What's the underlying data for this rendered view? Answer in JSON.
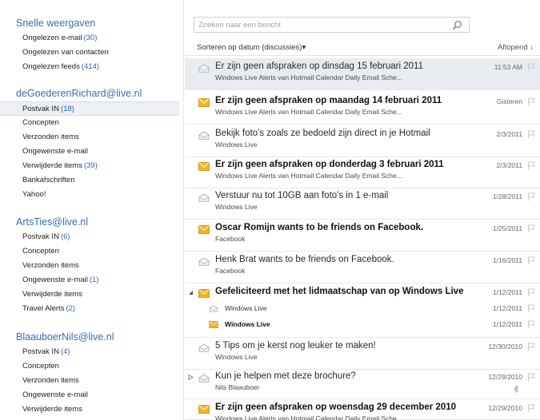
{
  "nav": {
    "quick_views": {
      "header": "Snelle weergaven",
      "items": [
        {
          "label": "Ongelezen e-mail",
          "count": "(30)"
        },
        {
          "label": "Ongelezen van contacten",
          "count": ""
        },
        {
          "label": "Ongelezen feeds",
          "count": "(414)"
        }
      ]
    },
    "accounts": [
      {
        "header": "deGoederenRichard@live.nl",
        "items": [
          {
            "label": "Postvak IN",
            "count": "(18)",
            "selected": true
          },
          {
            "label": "Concepten",
            "count": ""
          },
          {
            "label": "Verzonden items",
            "count": ""
          },
          {
            "label": "Ongewenste e-mail",
            "count": ""
          },
          {
            "label": "Verwijderde items",
            "count": "(39)"
          },
          {
            "label": "Bankafschriften",
            "count": ""
          },
          {
            "label": "Yahoo!",
            "count": ""
          }
        ]
      },
      {
        "header": "ArtsTies@live.nl",
        "items": [
          {
            "label": "Postvak IN",
            "count": "(6)"
          },
          {
            "label": "Concepten",
            "count": ""
          },
          {
            "label": "Verzonden items",
            "count": ""
          },
          {
            "label": "Ongewenste e-mail",
            "count": "(1)"
          },
          {
            "label": "Verwijderde items",
            "count": ""
          },
          {
            "label": "Travel Alerts",
            "count": "(2)"
          }
        ]
      },
      {
        "header": "BlaauboerNils@live.nl",
        "items": [
          {
            "label": "Postvak IN",
            "count": "(4)"
          },
          {
            "label": "Concepten",
            "count": ""
          },
          {
            "label": "Verzonden items",
            "count": ""
          },
          {
            "label": "Ongewenste e-mail",
            "count": ""
          },
          {
            "label": "Verwijderde items",
            "count": ""
          }
        ]
      }
    ]
  },
  "search": {
    "placeholder": "Zoeken naar een bericht",
    "icon": "search-icon"
  },
  "sort": {
    "label": "Sorteren op datum (discussies)",
    "arrow": "▾",
    "order": "Aflopend ↓"
  },
  "messages": [
    {
      "subject": "Er zijn geen afspraken op dinsdag 15 februari 2011",
      "sender": "Windows Live Alerts van Hotmail Calendar Daily Email Sche...",
      "date": "11:53 AM",
      "unread": false,
      "selected": true
    },
    {
      "subject": "Er zijn geen afspraken op maandag 14 februari 2011",
      "sender": "Windows Live Alerts van Hotmail Calendar Daily Email Sche...",
      "date": "Gisteren",
      "unread": true
    },
    {
      "subject": "Bekijk foto's zoals ze bedoeld zijn direct in je Hotmail",
      "sender": "Windows Live",
      "date": "2/3/2011",
      "unread": false
    },
    {
      "subject": "Er zijn geen afspraken op donderdag 3 februari 2011",
      "sender": "Windows Live Alerts van Hotmail Calendar Daily Email Sche...",
      "date": "2/3/2011",
      "unread": true
    },
    {
      "subject": "Verstuur nu tot 10GB aan foto's in 1 e-mail",
      "sender": "Windows Live",
      "date": "1/28/2011",
      "unread": false
    },
    {
      "subject": "Oscar Romijn wants to be friends on Facebook.",
      "sender": "Facebook",
      "date": "1/25/2011",
      "unread": true
    },
    {
      "subject": "Henk Brat wants to be friends on Facebook.",
      "sender": "Facebook",
      "date": "1/16/2011",
      "unread": false
    },
    {
      "subject": "Gefeliciteerd met het lidmaatschap van  op Windows Live",
      "sender": "",
      "date": "1/12/2011",
      "unread": true,
      "conversation": "expanded",
      "children": [
        {
          "name": "Windows Live",
          "date": "1/12/2011",
          "unread": false
        },
        {
          "name": "Windows Live",
          "date": "1/12/2011",
          "unread": true
        }
      ]
    },
    {
      "subject": "5 Tips om je kerst nog leuker te maken!",
      "sender": "Windows Live",
      "date": "12/30/2010",
      "unread": false
    },
    {
      "subject": "Kun je helpen met deze brochure?",
      "sender": "Nils Blaauboer",
      "date": "12/29/2010",
      "unread": false,
      "conversation": "collapsed",
      "attachment": true
    },
    {
      "subject": "Er zijn geen afspraken op woensdag 29 december 2010",
      "sender": "Windows Live Alerts van Hotmail Calendar Daily Email Sche...",
      "date": "12/29/2010",
      "unread": true
    }
  ],
  "colors": {
    "accent": "#3b6cab",
    "count": "#3063b8",
    "unread_envelope": "#f0b429",
    "read_envelope": "#a8b0ba",
    "selected_row": "#e8ecf1"
  }
}
